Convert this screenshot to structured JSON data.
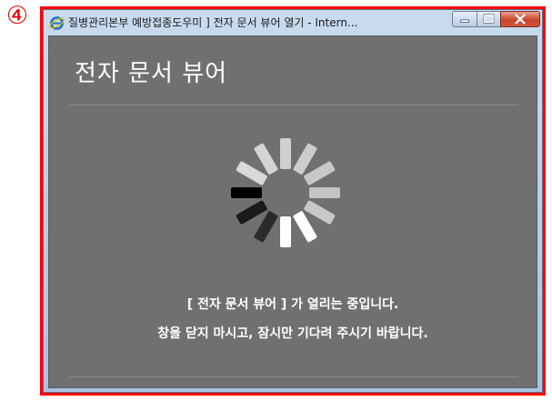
{
  "step_badge": "④",
  "window": {
    "title": "질병관리본부 예방접종도우미 ] 전자 문서 뷰어 열기 - Intern...",
    "controls": [
      "minimize",
      "maximize",
      "close"
    ]
  },
  "viewer": {
    "heading": "전자 문서 뷰어",
    "loading_message": "[ 전자 문서 뷰어 ] 가 열리는 중입니다.",
    "wait_message": "창을 닫지 마시고, 잠시만 기다려 주시기 바랍니다."
  },
  "colors": {
    "highlight": "#ff0000",
    "viewer_bg": "#707070",
    "text": "#ffffff"
  }
}
